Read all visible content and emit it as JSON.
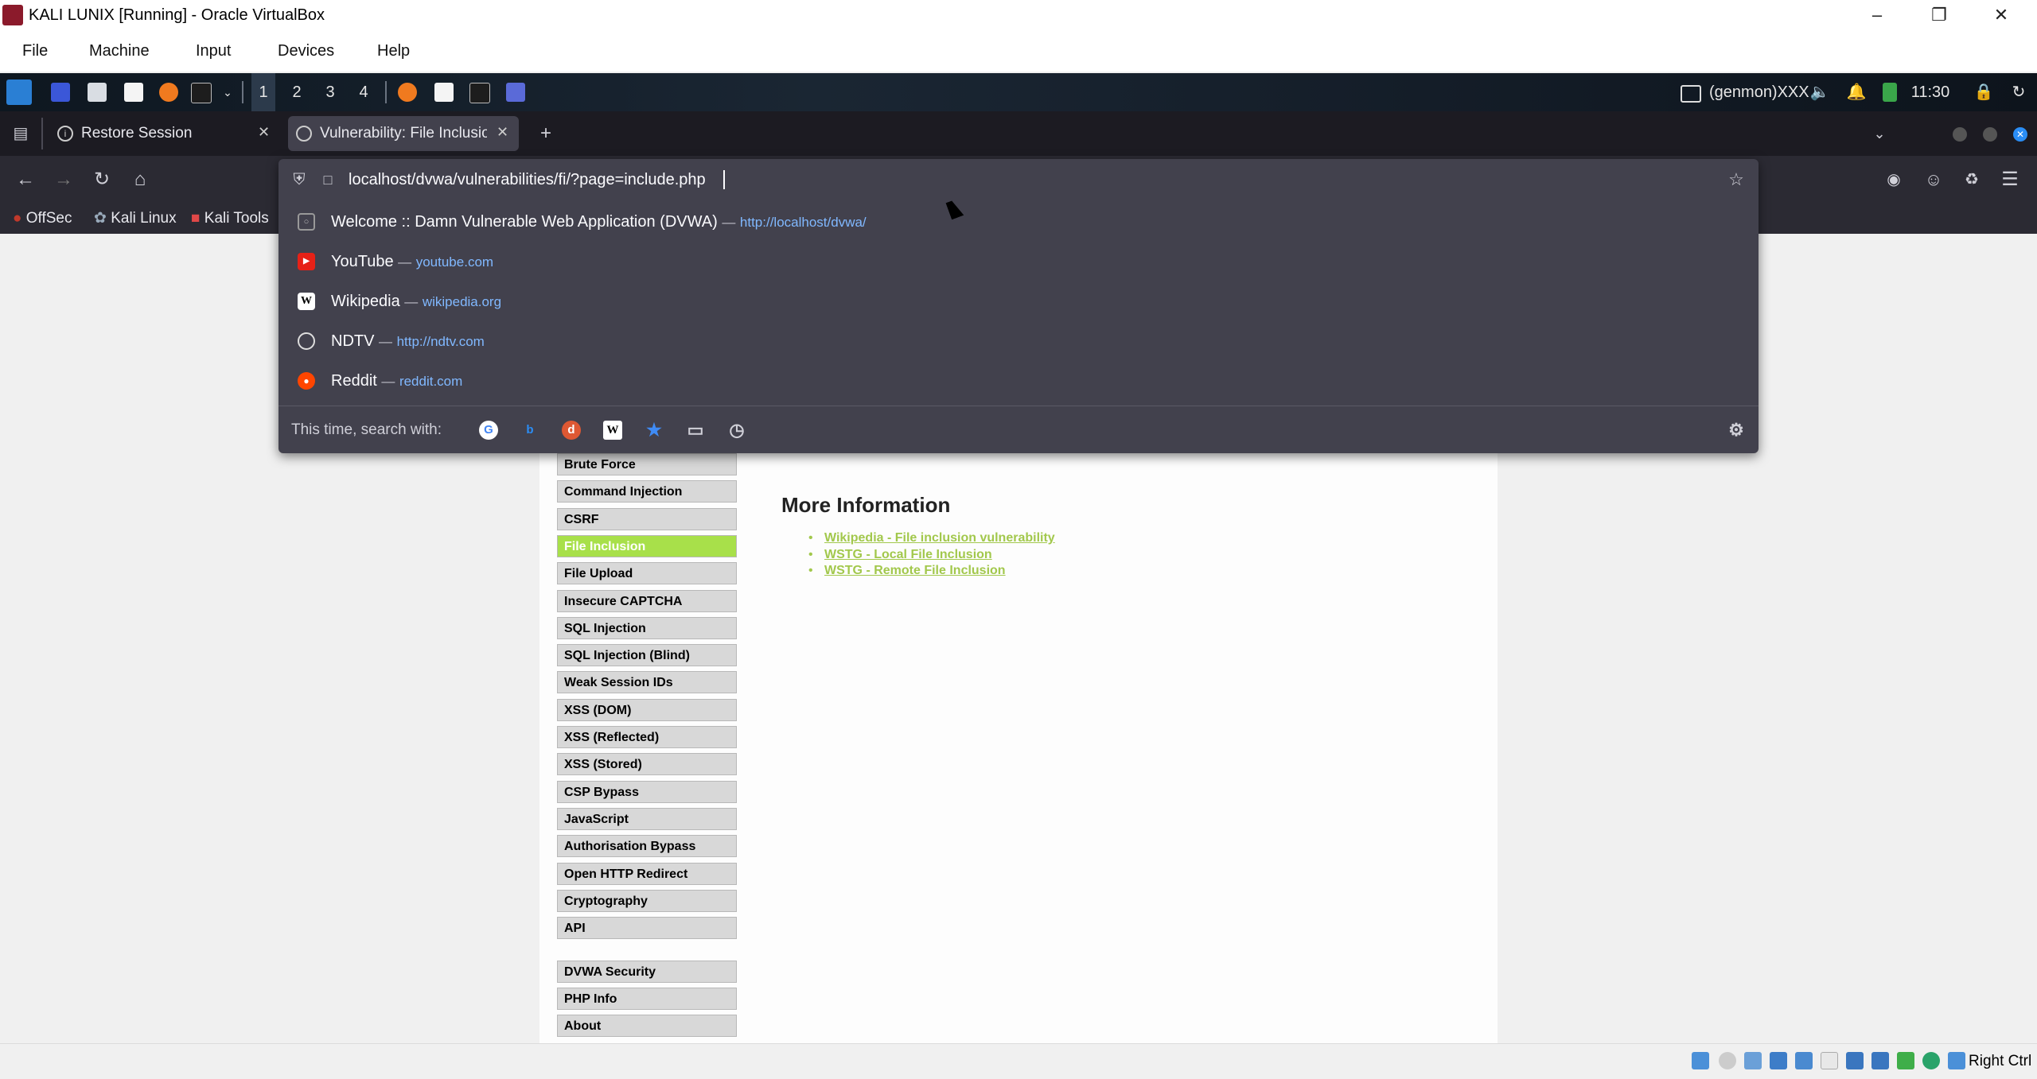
{
  "vbox": {
    "title": "KALI LUNIX [Running] - Oracle VirtualBox",
    "menu": [
      "File",
      "Machine",
      "Input",
      "Devices",
      "Help"
    ],
    "status_right": "Right Ctrl"
  },
  "panel": {
    "workspaces": [
      "1",
      "2",
      "3",
      "4"
    ],
    "genmon": "(genmon)XXX",
    "clock": "11:30"
  },
  "tabs": [
    {
      "label": "Restore Session"
    },
    {
      "label": "Vulnerability: File Inclusio"
    }
  ],
  "bookmarks": [
    "OffSec",
    "Kali Linux",
    "Kali Tools"
  ],
  "urlbar": {
    "value": "localhost/dvwa/vulnerabilities/fi/?page=include.php",
    "suggestions": [
      {
        "title": "Welcome :: Damn Vulnerable Web Application (DVWA)",
        "sep": "—",
        "url": "http://localhost/dvwa/",
        "icon": "globe-outline-icon"
      },
      {
        "title": "YouTube",
        "sep": "—",
        "url": "youtube.com",
        "icon": "youtube-icon"
      },
      {
        "title": "Wikipedia",
        "sep": "—",
        "url": "wikipedia.org",
        "icon": "wikipedia-icon"
      },
      {
        "title": "NDTV",
        "sep": "—",
        "url": "http://ndtv.com",
        "icon": "globe-icon"
      },
      {
        "title": "Reddit",
        "sep": "—",
        "url": "reddit.com",
        "icon": "reddit-icon"
      }
    ],
    "search_with": "This time, search with:"
  },
  "dvwa": {
    "menu": [
      {
        "label": "Brute Force",
        "active": false
      },
      {
        "label": "Command Injection",
        "active": false
      },
      {
        "label": "CSRF",
        "active": false
      },
      {
        "label": "File Inclusion",
        "active": true
      },
      {
        "label": "File Upload",
        "active": false
      },
      {
        "label": "Insecure CAPTCHA",
        "active": false
      },
      {
        "label": "SQL Injection",
        "active": false
      },
      {
        "label": "SQL Injection (Blind)",
        "active": false
      },
      {
        "label": "Weak Session IDs",
        "active": false
      },
      {
        "label": "XSS (DOM)",
        "active": false
      },
      {
        "label": "XSS (Reflected)",
        "active": false
      },
      {
        "label": "XSS (Stored)",
        "active": false
      },
      {
        "label": "CSP Bypass",
        "active": false
      },
      {
        "label": "JavaScript",
        "active": false
      },
      {
        "label": "Authorisation Bypass",
        "active": false
      },
      {
        "label": "Open HTTP Redirect",
        "active": false
      },
      {
        "label": "Cryptography",
        "active": false
      },
      {
        "label": "API",
        "active": false
      }
    ],
    "menu2": [
      "DVWA Security",
      "PHP Info",
      "About"
    ],
    "more_info_title": "More Information",
    "links": [
      "Wikipedia - File inclusion vulnerability",
      "WSTG - Local File Inclusion",
      "WSTG - Remote File Inclusion"
    ]
  },
  "colors": {
    "active_menu": "#a8e04a",
    "link": "#a2c84c",
    "url_dark": "#42414d"
  }
}
